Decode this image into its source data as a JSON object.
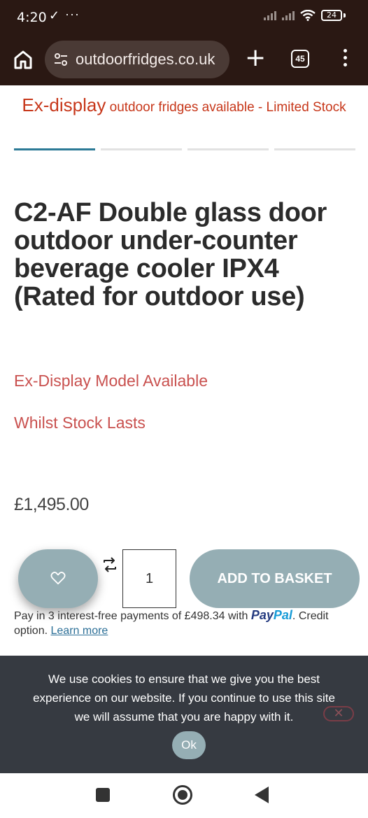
{
  "status_bar": {
    "time": "4:20",
    "battery": "24"
  },
  "browser": {
    "url": "outdoorfridges.co.uk",
    "tab_count": "45"
  },
  "banner": {
    "highlight": "Ex-display",
    "text": "outdoor fridges available - Limited Stock"
  },
  "product": {
    "title": "C2-AF Double glass door outdoor under-counter beverage cooler IPX4 (Rated for outdoor use)",
    "promo_1": "Ex-Display Model Available",
    "promo_2": "Whilst Stock Lasts",
    "price": "£1,495.00",
    "quantity": "1",
    "add_to_basket": "ADD TO BASKET"
  },
  "paypal": {
    "text_1": "Pay in 3 interest-free payments of £498.34 with",
    "logo_pay": "Pay",
    "logo_pal": "Pal",
    "text_2": ". Credit option.",
    "learn_more": "Learn more"
  },
  "cookie": {
    "message": "We use cookies to ensure that we give you the best experience on our website. If you continue to use this site we will assume that you are happy with it.",
    "ok": "Ok",
    "close": "✕"
  },
  "colors": {
    "accent": "#95aeb4",
    "banner": "#c7371a",
    "promo": "#c9514f",
    "cookie_bg": "#363a41"
  }
}
